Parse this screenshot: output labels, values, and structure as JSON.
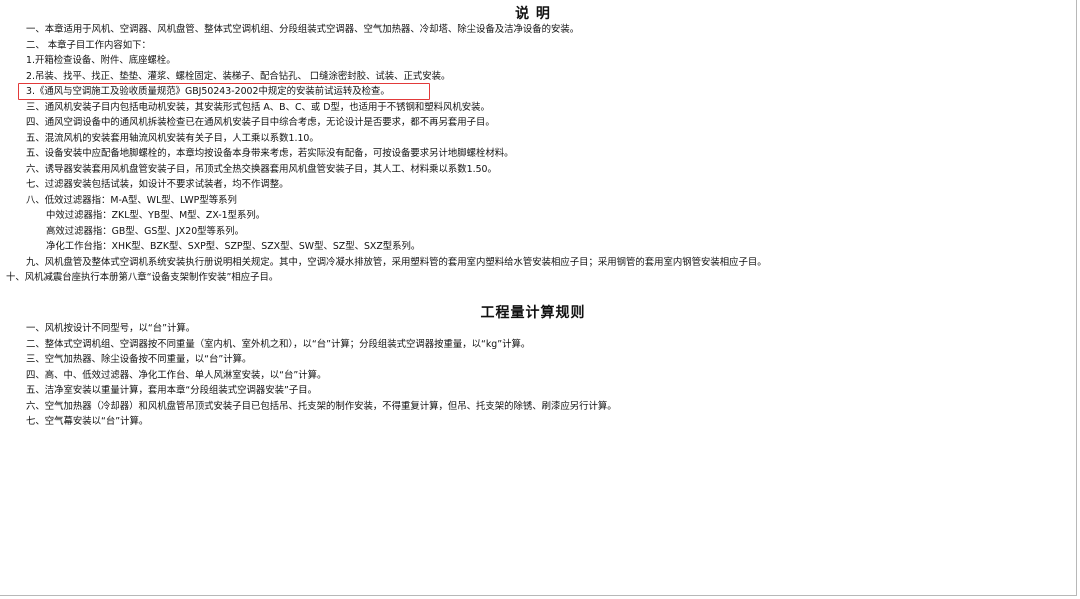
{
  "section1": {
    "title": "说  明",
    "lines": [
      "一、本章适用于风机、空调器、风机盘管、整体式空调机组、分段组装式空调器、空气加热器、冷却塔、除尘设备及洁净设备的安装。",
      "二、      本章子目工作内容如下：",
      "1.开箱检查设备、附件、底座螺栓。",
      "2.吊装、找平、找正、垫垫、灌浆、螺栓固定、装梯子、配合钻孔、  口缝涂密封胶、试装、正式安装。",
      "3.《通风与空调施工及验收质量规范》GBJ50243-2002中规定的安装前试运转及检查。",
      "三、通风机安装子目内包括电动机安装，其安装形式包括 A、B、C、或 D型，也适用于不锈钢和塑料风机安装。",
      "四、通风空调设备中的通风机拆装检查已在通风机安装子目中综合考虑，无论设计是否要求，都不再另套用子目。",
      "五、混流风机的安装套用轴流风机安装有关子目，人工乘以系数1.10。",
      "五、设备安装中应配备地脚螺栓的，本章均按设备本身带来考虑，若实际没有配备，可按设备要求另计地脚螺栓材料。",
      "六、诱导器安装套用风机盘管安装子目，吊顶式全热交换器套用风机盘管安装子目，其人工、材料乘以系数1.50。",
      "七、过滤器安装包括试装，如设计不要求试装者，均不作调整。",
      "八、低效过滤器指：M-A型、WL型、LWP型等系列",
      "中效过滤器指：ZKL型、YB型、M型、ZX-1型系列。",
      "高效过滤器指：GB型、GS型、JX20型等系列。",
      "净化工作台指：XHK型、BZK型、SXP型、SZP型、SZX型、SW型、SZ型、SXZ型系列。",
      "九、风机盘管及整体式空调机系统安装执行册说明相关规定。其中，空调冷凝水排放管，采用塑料管的套用室内塑料给水管安装相应子目；采用钢管的套用室内钢管安装相应子目。",
      "十、风机减震台座执行本册第八章“设备支架制作安装”相应子目。"
    ]
  },
  "section2": {
    "title": "工程量计算规则",
    "lines": [
      "一、风机按设计不同型号，以“台”计算。",
      "二、整体式空调机组、空调器按不同重量（室内机、室外机之和），以“台”计算；分段组装式空调器按重量，以“kg”计算。",
      "三、空气加热器、除尘设备按不同重量，以“台”计算。",
      "四、高、中、低效过滤器、净化工作台、单人风淋室安装，以“台”计算。",
      "五、洁净室安装以重量计算，套用本章“分段组装式空调器安装”子目。",
      "六、空气加热器（冷却器）和风机盘管吊顶式安装子目已包括吊、托支架的制作安装，不得重复计算，但吊、托支架的除锈、刷漆应另行计算。",
      "七、空气幕安装以“台”计算。"
    ]
  }
}
